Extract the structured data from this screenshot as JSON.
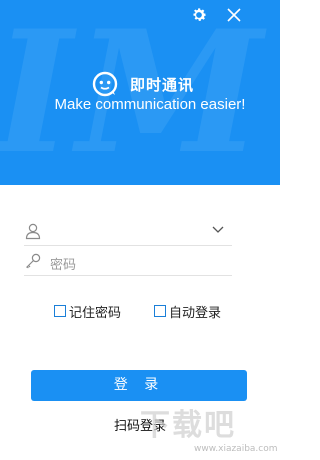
{
  "header": {
    "bg_letters": "IM",
    "app_name": "即时通讯",
    "slogan": "Make communication easier!",
    "bg_color": "#1a90f3"
  },
  "window_controls": {
    "settings_icon": "gear-icon",
    "close_icon": "close-icon"
  },
  "form": {
    "account_value": "",
    "password_placeholder": "密码",
    "remember_label": "记住密码",
    "remember_checked": false,
    "auto_login_label": "自动登录",
    "auto_login_checked": false,
    "login_label": "登 录",
    "qr_login_label": "扫码登录"
  },
  "watermark": {
    "text": "下载吧",
    "url": "www.xiazaiba.com"
  }
}
